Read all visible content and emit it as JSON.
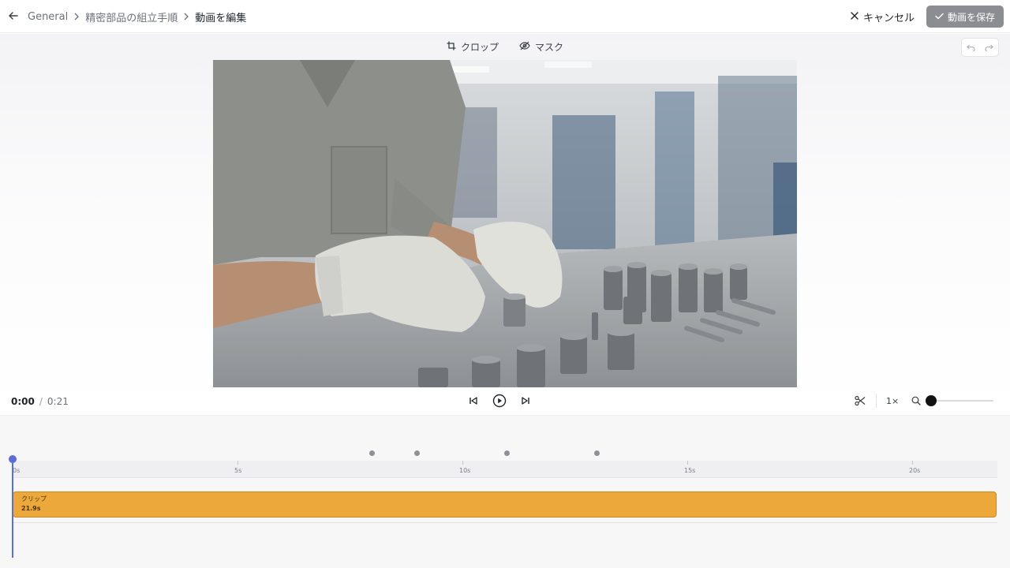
{
  "header": {
    "breadcrumb": [
      "General",
      "精密部品の組立手順",
      "動画を編集"
    ],
    "cancel_label": "キャンセル",
    "save_label": "動画を保存"
  },
  "toolbar": {
    "crop_label": "クロップ",
    "mask_label": "マスク"
  },
  "player": {
    "current_time": "0:00",
    "separator": "/",
    "total_time": "0:21",
    "speed": "1×",
    "zoom_level": 0
  },
  "timeline": {
    "ruler_labels": [
      "0s",
      "5s",
      "10s",
      "15s",
      "20s"
    ],
    "marker_count": 4,
    "clip": {
      "label": "クリップ",
      "duration": "21.9s"
    }
  },
  "colors": {
    "accent": "#5b6fd6",
    "clip": "#eca83a",
    "save_button": "#8b8d92"
  }
}
